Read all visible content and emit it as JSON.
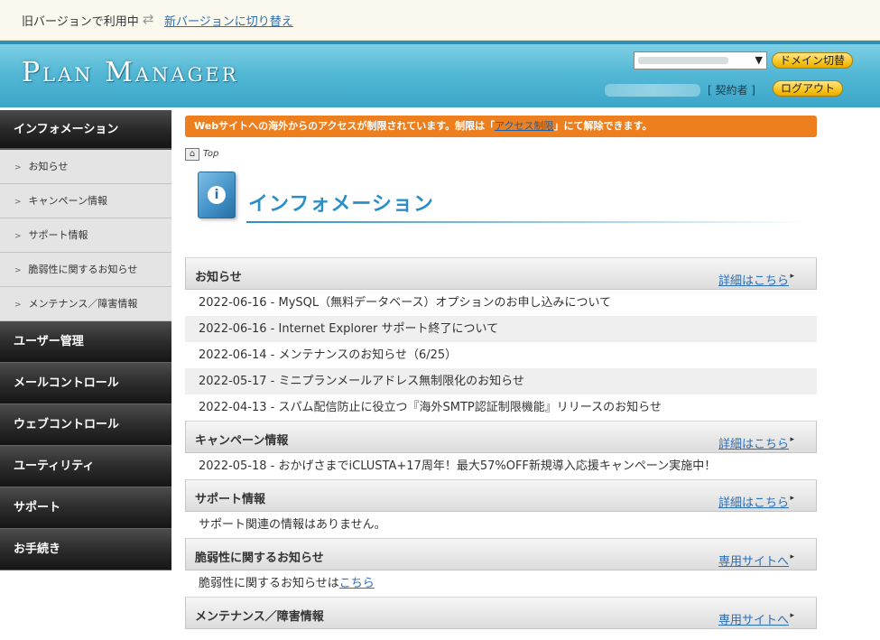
{
  "topbar": {
    "old_version_text": "旧バージョンで利用中",
    "swap_icon": "swap-arrows-icon",
    "new_version_link": "新バージョンに切り替え"
  },
  "header": {
    "logo": "Plan Manager",
    "domain_switch_label": "ドメイン切替",
    "contract_label": "[ 契約者 ]",
    "logout_label": "ログアウト"
  },
  "sidebar": {
    "sections": [
      {
        "label": "インフォメーション",
        "items": [
          "お知らせ",
          "キャンペーン情報",
          "サポート情報",
          "脆弱性に関するお知らせ",
          "メンテナンス／障害情報"
        ]
      }
    ],
    "categories": [
      "ユーザー管理",
      "メールコントロール",
      "ウェブコントロール",
      "ユーティリティ",
      "サポート",
      "お手続き"
    ]
  },
  "alert": {
    "text_before": "Webサイトへの海外からのアクセスが制限されています。制限は「",
    "link": "アクセス制限",
    "text_after": "」にて解除できます。"
  },
  "breadcrumb": {
    "top": "Top"
  },
  "page_title": "インフォメーション",
  "sections": {
    "news": {
      "title": "お知らせ",
      "more": "詳細はこちら",
      "items": [
        "2022-06-16 - MySQL（無料データベース）オプションのお申し込みについて",
        "2022-06-16 - Internet Explorer サポート終了について",
        "2022-06-14 - メンテナンスのお知らせ（6/25）",
        "2022-05-17 - ミニプランメールアドレス無制限化のお知らせ",
        "2022-04-13 - スパム配信防止に役立つ『海外SMTP認証制限機能』リリースのお知らせ"
      ]
    },
    "campaign": {
      "title": "キャンペーン情報",
      "more": "詳細はこちら",
      "items": [
        "2022-05-18 - おかげさまでiCLUSTA+17周年！最大57%OFF新規導入応援キャンペーン実施中！"
      ]
    },
    "support": {
      "title": "サポート情報",
      "more": "詳細はこちら",
      "text": "サポート関連の情報はありません。"
    },
    "vuln": {
      "title": "脆弱性に関するお知らせ",
      "more": "専用サイトへ",
      "text_before": "脆弱性に関するお知らせは",
      "link": "こちら"
    },
    "maint": {
      "title": "メンテナンス／障害情報",
      "more": "専用サイトへ"
    }
  },
  "colors": {
    "header_blue": "#54b9d6",
    "alert_orange": "#ee7f1e",
    "title_blue": "#2a8fc8",
    "link_blue": "#2b6fb5",
    "button_yellow": "#f7c51e"
  }
}
